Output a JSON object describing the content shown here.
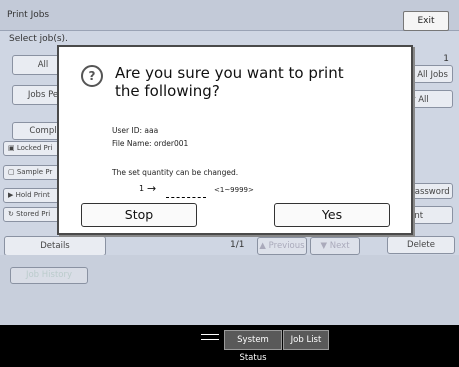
{
  "header": {
    "title": "Print Jobs",
    "exit_label": "Exit"
  },
  "background": {
    "select_label": "Select job(s).",
    "all_label": "All",
    "jobs_per_label": "Jobs Pe",
    "complete_label": "Compl",
    "locked_label": "Locked Pri",
    "sample_label": "Sample Pr",
    "hold_label": "Hold Print",
    "stored_label": "Stored Pri",
    "details_label": "Details",
    "page_indicator": "1/1",
    "prev_label": "Previous",
    "next_label": "Next",
    "count_value": "1",
    "all_jobs_label": "All Jobs",
    "clear_all_label": "r All",
    "password_label": "Password",
    "print_label": "int",
    "delete_label": "Delete",
    "job_history_label": "Job History"
  },
  "dialog": {
    "title": "Are you sure you want to print the following?",
    "user_id": "User ID: aaa",
    "file_name": "File Name: order001",
    "change_note": "The set quantity can be changed.",
    "quantity": "1",
    "range": "<1~9999>",
    "stop_label": "Stop",
    "yes_label": "Yes"
  },
  "statusbar": {
    "system_status_label": "System Status",
    "job_list_label": "Job List"
  }
}
